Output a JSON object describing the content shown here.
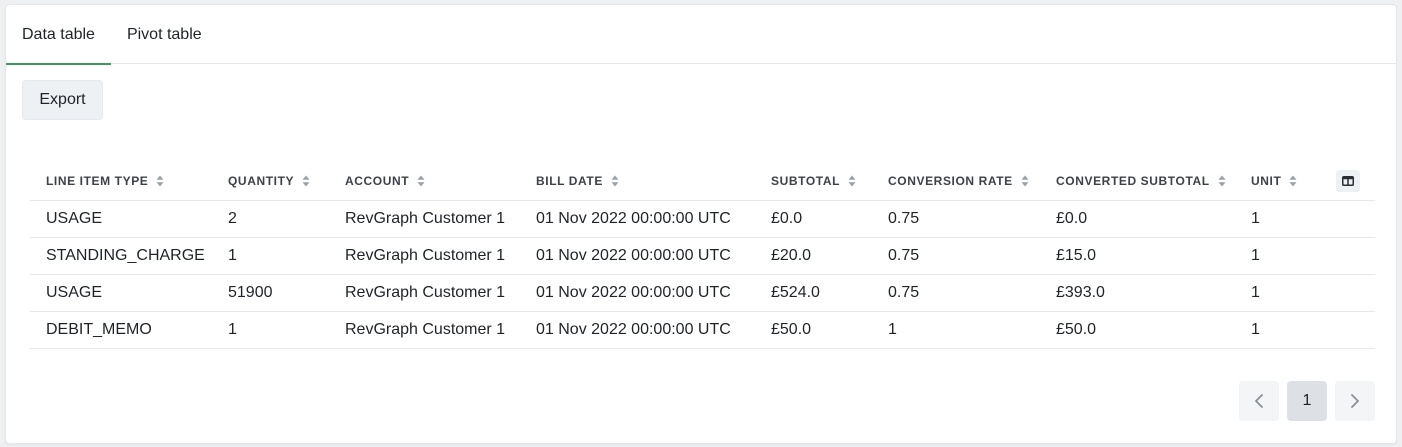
{
  "tabs": [
    {
      "label": "Data table",
      "active": true
    },
    {
      "label": "Pivot table",
      "active": false
    }
  ],
  "toolbar": {
    "export_label": "Export"
  },
  "table": {
    "columns": [
      "LINE ITEM TYPE",
      "QUANTITY",
      "ACCOUNT",
      "BILL DATE",
      "SUBTOTAL",
      "CONVERSION RATE",
      "CONVERTED SUBTOTAL",
      "UNIT"
    ],
    "rows": [
      [
        "USAGE",
        "2",
        "RevGraph Customer 1",
        "01 Nov 2022 00:00:00 UTC",
        "£0.0",
        "0.75",
        "£0.0",
        "1"
      ],
      [
        "STANDING_CHARGE",
        "1",
        "RevGraph Customer 1",
        "01 Nov 2022 00:00:00 UTC",
        "£20.0",
        "0.75",
        "£15.0",
        "1"
      ],
      [
        "USAGE",
        "51900",
        "RevGraph Customer 1",
        "01 Nov 2022 00:00:00 UTC",
        "£524.0",
        "0.75",
        "£393.0",
        "1"
      ],
      [
        "DEBIT_MEMO",
        "1",
        "RevGraph Customer 1",
        "01 Nov 2022 00:00:00 UTC",
        "£50.0",
        "1",
        "£50.0",
        "1"
      ]
    ]
  },
  "pagination": {
    "current_page": "1"
  },
  "colors": {
    "accent": "#3a9a63",
    "button_bg": "#eef1f4",
    "page_active_bg": "#dde1e6"
  }
}
